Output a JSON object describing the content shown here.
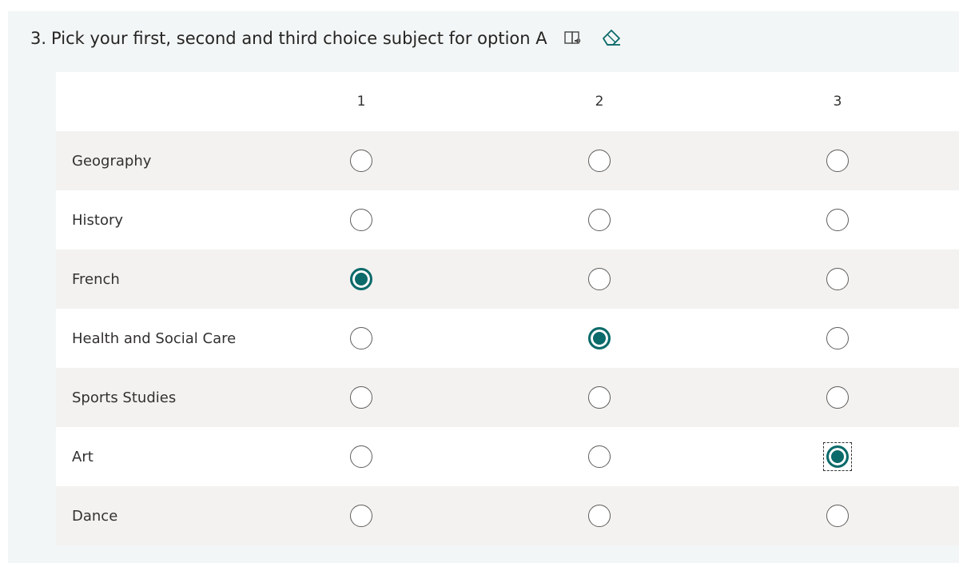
{
  "question": {
    "number": "3.",
    "text": "Pick your first, second and third choice subject for option A",
    "immersive_reader_icon": "immersive-reader-icon",
    "clear_icon": "eraser-icon"
  },
  "columns": [
    "1",
    "2",
    "3"
  ],
  "rows": [
    {
      "label": "Geography",
      "selected": null
    },
    {
      "label": "History",
      "selected": null
    },
    {
      "label": "French",
      "selected": 1
    },
    {
      "label": "Health and Social Care",
      "selected": 2
    },
    {
      "label": "Sports Studies",
      "selected": null
    },
    {
      "label": "Art",
      "selected": 3
    },
    {
      "label": "Dance",
      "selected": null
    }
  ],
  "focused": {
    "row": 5,
    "column": 3
  },
  "colors": {
    "accent": "#0b6a6a",
    "card_background": "#f3f6f6",
    "row_alt": "#f3f2f1"
  }
}
